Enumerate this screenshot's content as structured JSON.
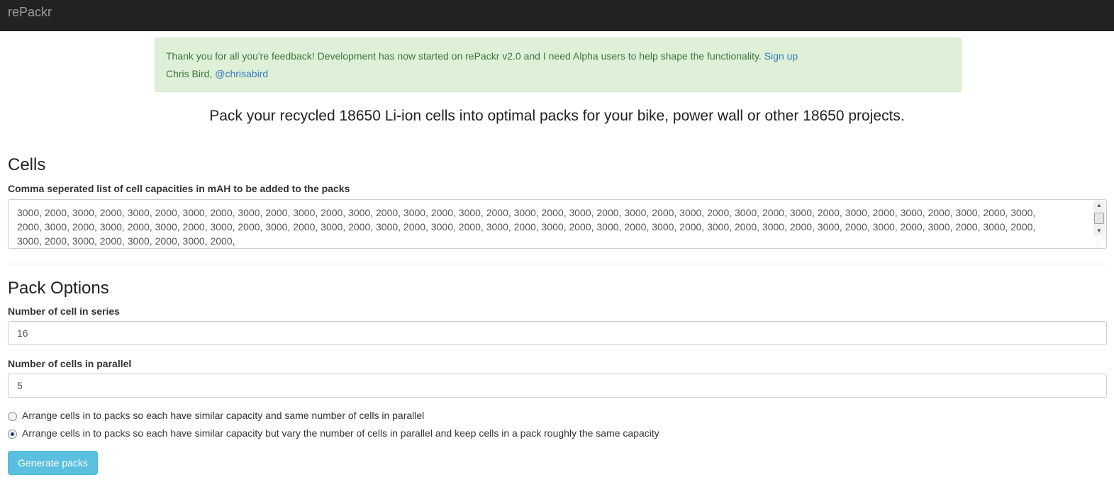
{
  "navbar": {
    "brand": "rePackr"
  },
  "alert": {
    "message": "Thank you for all you're feedback! Development has now started on rePackr v2.0 and I need Alpha users to help shape the functionality.",
    "signup_link": "Sign up",
    "author": "Chris Bird,",
    "twitter_link": "@chrisabird"
  },
  "lead": "Pack your recycled 18650 Li-ion cells into optimal packs for your bike, power wall or other 18650 projects.",
  "cells": {
    "heading": "Cells",
    "label": "Comma seperated list of cell capacities in mAH to be added to the packs",
    "lines": [
      "3000, 2000, 3000, 2000, 3000, 2000, 3000, 2000, 3000, 2000, 3000, 2000, 3000, 2000, 3000, 2000, 3000, 2000, 3000, 2000, 3000, 2000, 3000, 2000, 3000, 2000, 3000, 2000, 3000, 2000, 3000, 2000, 3000, 2000, 3000, 2000, 3000,",
      "2000, 3000, 2000, 3000, 2000, 3000, 2000, 3000, 2000, 3000, 2000, 3000, 2000, 3000, 2000, 3000, 2000, 3000, 2000, 3000, 2000, 3000, 2000, 3000, 2000, 3000, 2000, 3000, 2000, 3000, 2000, 3000, 2000, 3000, 2000, 3000, 2000,",
      "3000, 2000, 3000, 2000, 3000, 2000, 3000, 2000,"
    ]
  },
  "pack_options": {
    "heading": "Pack Options",
    "series_label": "Number of cell in series",
    "series_value": "16",
    "parallel_label": "Number of cells in parallel",
    "parallel_value": "5",
    "radio_options": [
      {
        "label": "Arrange cells in to packs so each have similar capacity and same number of cells in parallel",
        "checked": false
      },
      {
        "label": "Arrange cells in to packs so each have similar capacity but vary the number of cells in parallel and keep cells in a pack roughly the same capacity",
        "checked": true
      }
    ]
  },
  "generate_button": "Generate packs",
  "colors": {
    "navbar_bg": "#222222",
    "alert_bg": "#dff0d8",
    "alert_text": "#3c763d",
    "link": "#337ab7",
    "button_bg": "#5bc0de"
  }
}
